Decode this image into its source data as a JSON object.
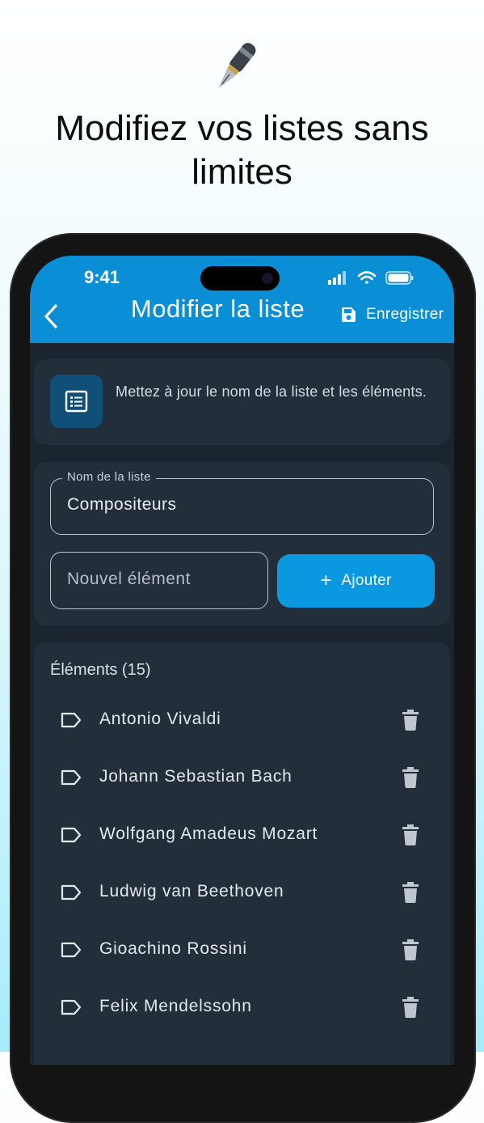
{
  "promo": {
    "headline_line1": "Modifiez vos listes sans",
    "headline_line2": "limites",
    "icon": "fountain-pen-icon"
  },
  "status_bar": {
    "time": "9:41"
  },
  "appbar": {
    "title": "Modifier la liste",
    "save_label": "Enregistrer",
    "color": "#0a8fd6"
  },
  "info": {
    "text": "Mettez à jour le nom de la liste et les éléments."
  },
  "form": {
    "name_label": "Nom de la liste",
    "name_value": "Compositeurs",
    "new_item_placeholder": "Nouvel élément",
    "add_label": "Ajouter"
  },
  "items": {
    "header": "Éléments (15)",
    "list": [
      "Antonio Vivaldi",
      "Johann Sebastian Bach",
      "Wolfgang Amadeus Mozart",
      "Ludwig van Beethoven",
      "Gioachino Rossini",
      "Felix Mendelssohn"
    ]
  },
  "colors": {
    "accent": "#0a98e0",
    "card": "#222f3b",
    "background": "#1b2530"
  }
}
